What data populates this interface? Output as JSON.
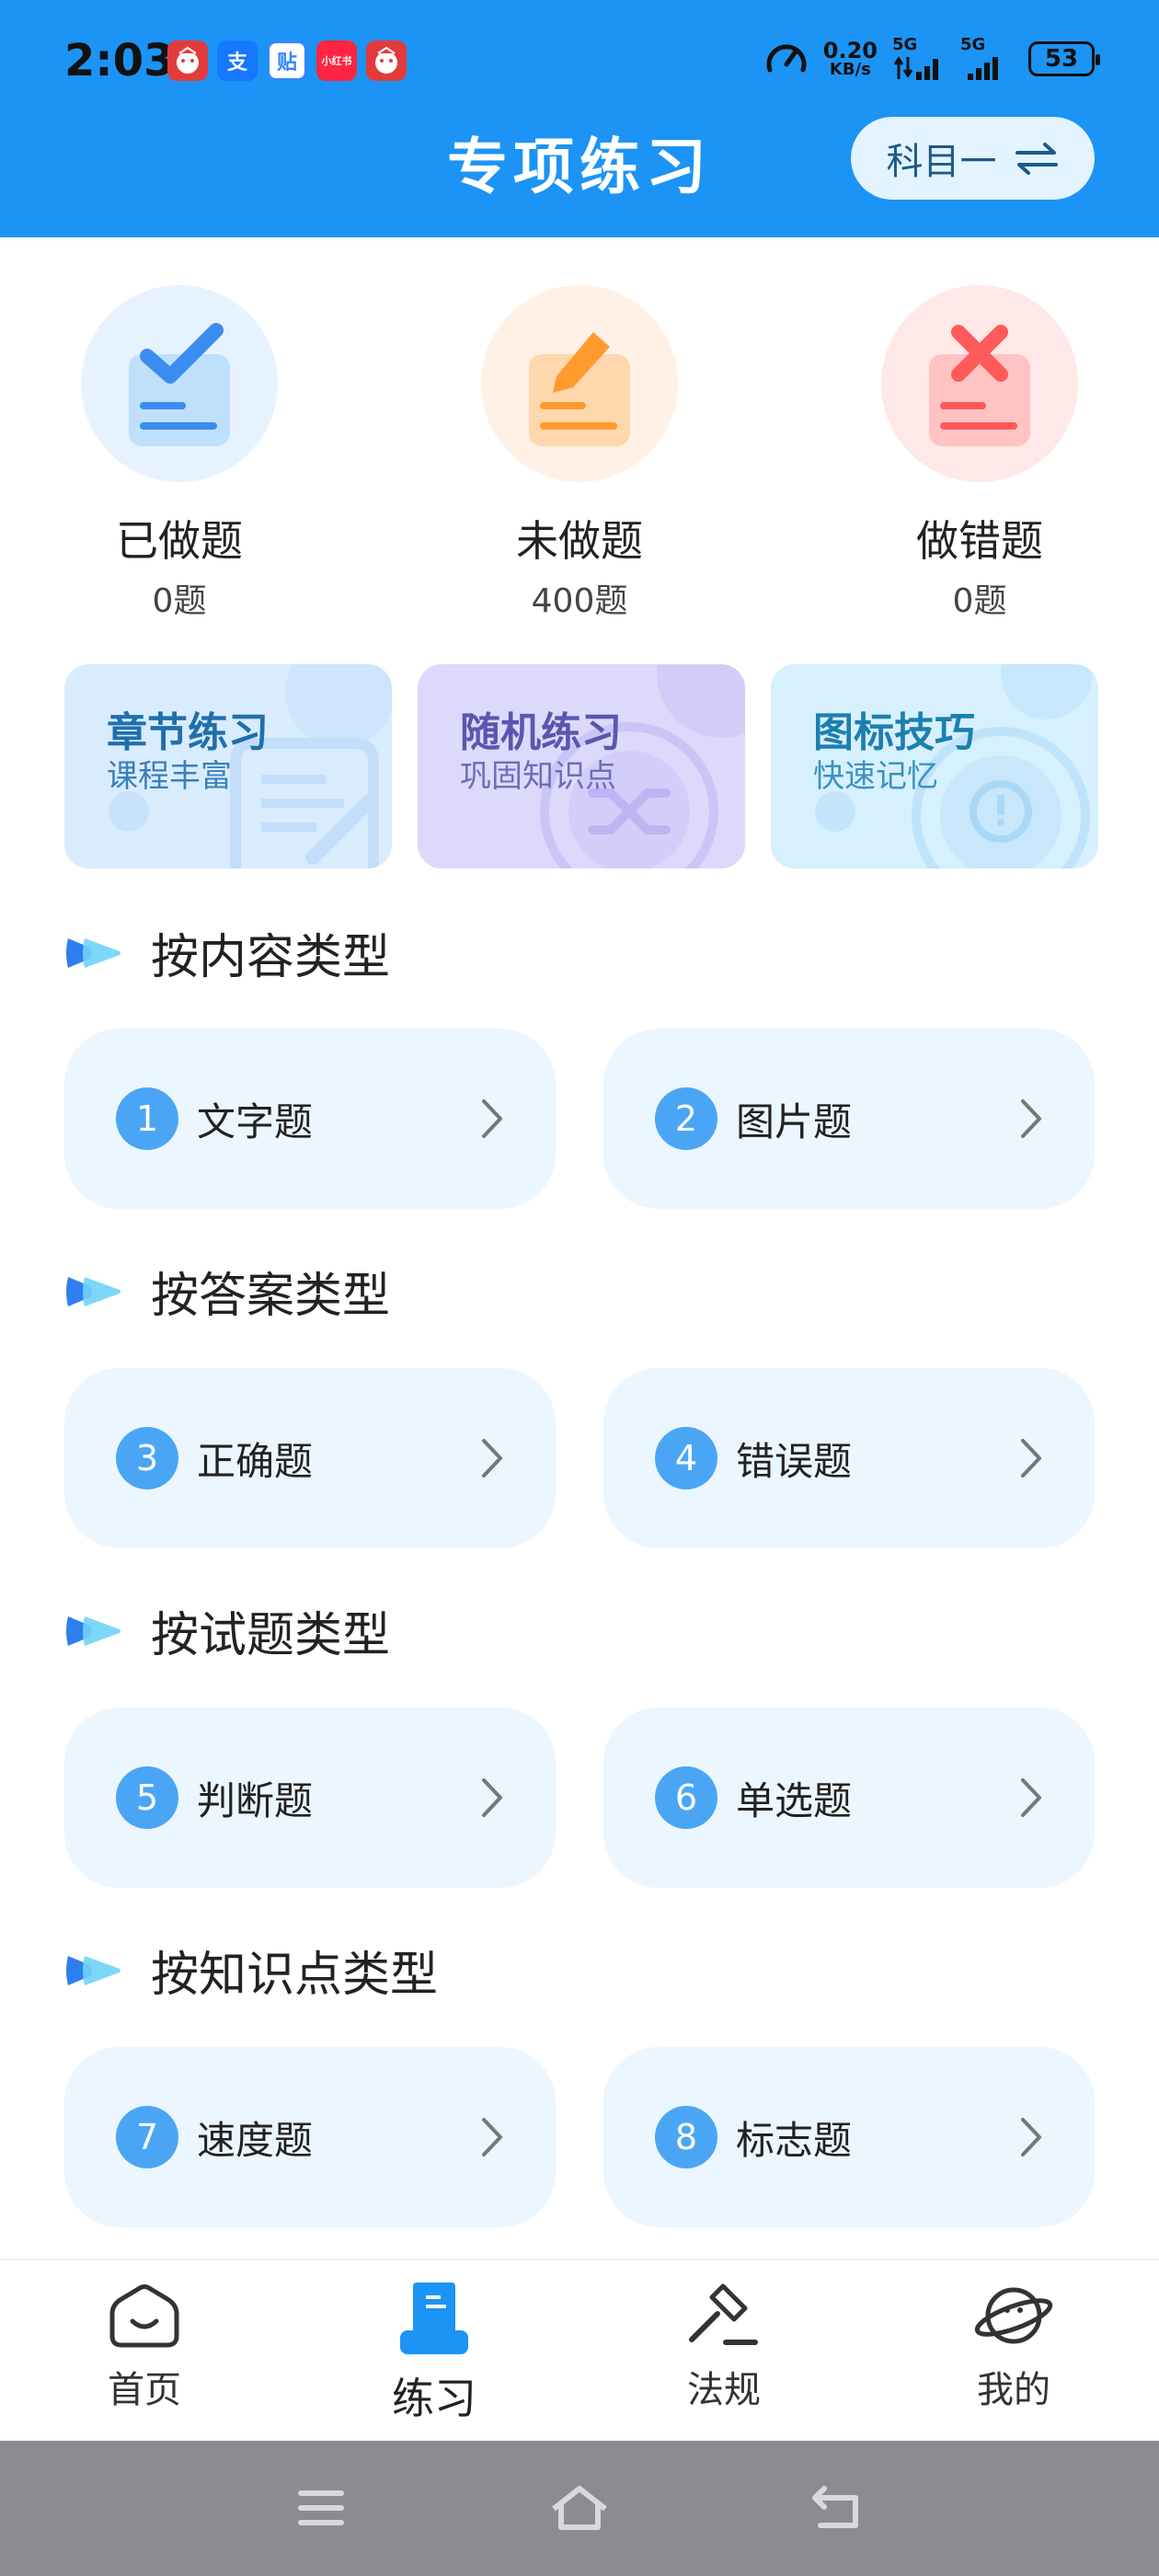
{
  "status_bar": {
    "time": "2:03",
    "app_icons": [
      {
        "name": "app-icon-1",
        "glyph": "",
        "color": "#e33b3b"
      },
      {
        "name": "alipay-icon",
        "glyph": "支",
        "color": "#1677ff"
      },
      {
        "name": "tieba-icon",
        "glyph": "贴",
        "color": "#3385ff"
      },
      {
        "name": "xiaohongshu-icon",
        "glyph": "小红书",
        "color": "#ff2442"
      },
      {
        "name": "app-icon-5",
        "glyph": "",
        "color": "#e33b3b"
      }
    ],
    "net_speed_value": "0.20",
    "net_speed_unit": "KB/s",
    "signal1_label": "5G",
    "signal2_label": "5G",
    "battery": "53"
  },
  "header": {
    "title": "专项练习",
    "subject_label": "科目一"
  },
  "stats": [
    {
      "label": "已做题",
      "count": "0题",
      "color": "#3b8cf0",
      "bg": "#e6f3ff"
    },
    {
      "label": "未做题",
      "count": "400题",
      "color": "#ff9a2e",
      "bg": "#fff1e6"
    },
    {
      "label": "做错题",
      "count": "0题",
      "color": "#ff5a5a",
      "bg": "#ffe8e8"
    }
  ],
  "cards": [
    {
      "title": "章节练习",
      "subtitle": "课程丰富",
      "bg": "#d9ecfd",
      "title_color": "#1f6fae",
      "sub_color": "#3b7fb8"
    },
    {
      "title": "随机练习",
      "subtitle": "巩固知识点",
      "bg": "#ddd9fb",
      "title_color": "#5a56b0",
      "sub_color": "#6f6cba"
    },
    {
      "title": "图标技巧",
      "subtitle": "快速记忆",
      "bg": "#d6f0fd",
      "title_color": "#1c7fb0",
      "sub_color": "#3a93c0"
    }
  ],
  "sections": [
    {
      "title": "按内容类型",
      "items": [
        {
          "num": "1",
          "label": "文字题"
        },
        {
          "num": "2",
          "label": "图片题"
        }
      ]
    },
    {
      "title": "按答案类型",
      "items": [
        {
          "num": "3",
          "label": "正确题"
        },
        {
          "num": "4",
          "label": "错误题"
        }
      ]
    },
    {
      "title": "按试题类型",
      "items": [
        {
          "num": "5",
          "label": "判断题"
        },
        {
          "num": "6",
          "label": "单选题"
        }
      ]
    },
    {
      "title": "按知识点类型",
      "items": [
        {
          "num": "7",
          "label": "速度题"
        },
        {
          "num": "8",
          "label": "标志题"
        }
      ]
    }
  ],
  "bottom_nav": [
    {
      "label": "首页",
      "icon": "home-icon",
      "active": false
    },
    {
      "label": "练习",
      "icon": "practice-icon",
      "active": true
    },
    {
      "label": "法规",
      "icon": "gavel-icon",
      "active": false
    },
    {
      "label": "我的",
      "icon": "planet-icon",
      "active": false
    }
  ],
  "colors": {
    "header_bg": "#1b94f5",
    "tile_bg": "#ebf6fe",
    "badge_bg": "#4aa6f5",
    "active_nav": "#1b94f5"
  }
}
